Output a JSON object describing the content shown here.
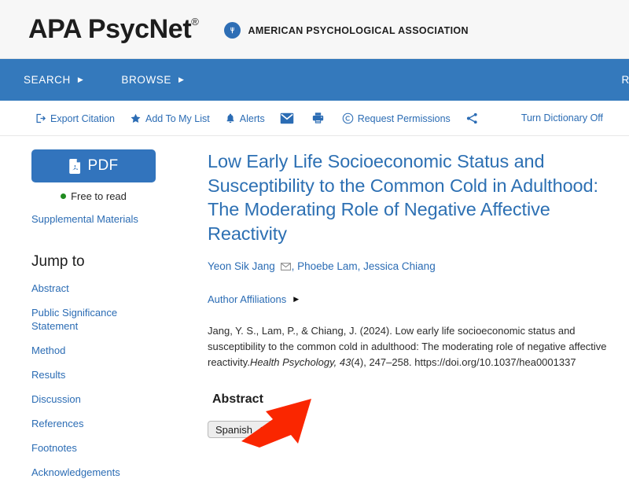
{
  "header": {
    "logo_text": "APA PsycNet",
    "logo_registered": "®",
    "org_icon": "apa-psi-seal-icon",
    "org_name": "AMERICAN PSYCHOLOGICAL ASSOCIATION"
  },
  "navbar": {
    "items": [
      {
        "label": "SEARCH",
        "caret": "▶",
        "icon": "chevron-right-icon"
      },
      {
        "label": "BROWSE",
        "caret": "▶",
        "icon": "chevron-right-icon"
      }
    ],
    "right_item": "Rece",
    "background_color": "#3479bc"
  },
  "toolbar": {
    "buttons": [
      {
        "label": "Export Citation",
        "icon": "export-citation-icon"
      },
      {
        "label": "Add To My List",
        "icon": "star-icon"
      },
      {
        "label": "Alerts",
        "icon": "bell-icon"
      },
      {
        "label": "",
        "icon": "envelope-icon"
      },
      {
        "label": "",
        "icon": "printer-icon"
      },
      {
        "label": "Request Permissions",
        "icon": "copyright-icon"
      },
      {
        "label": "",
        "icon": "share-icon"
      }
    ],
    "dictionary_toggle": "Turn Dictionary Off"
  },
  "sidebar": {
    "pdf_button": {
      "label": "PDF",
      "icon": "pdf-file-icon"
    },
    "free_to_read": "Free to read",
    "free_dot_color": "#1f8b1f",
    "supplemental_link": "Supplemental Materials",
    "jump_to_title": "Jump to",
    "jump_links": [
      "Abstract",
      "Public Significance Statement",
      "Method",
      "Results",
      "Discussion",
      "References",
      "Footnotes",
      "Acknowledgements"
    ]
  },
  "article": {
    "title": "Low Early Life Socioeconomic Status and Susceptibility to the Common Cold in Adulthood: The Moderating Role of Negative Affective Reactivity",
    "title_color": "#2d70b3",
    "authors_prefix": "Yeon Sik Jang",
    "authors_email_icon": "envelope-small-icon",
    "authors_rest": ", Phoebe Lam, Jessica Chiang",
    "author_affiliations_label": "Author Affiliations",
    "author_affiliations_caret": "▶",
    "citation_part1": "Jang, Y. S., Lam, P., & Chiang, J. (2024). Low early life socioeconomic status and susceptibility to the common cold in adulthood: The moderating role of negative affective reactivity.",
    "citation_journal": "Health Psychology, 43",
    "citation_part2": "(4), 247–258. https://doi.org/10.1037/hea0001337",
    "abstract_heading": "Abstract",
    "language_select_value": "Spanish",
    "language_select_caret": "⌄"
  },
  "annotation": {
    "arrow_color": "#fa2600",
    "arrow_name": "red-pointer-arrow"
  }
}
